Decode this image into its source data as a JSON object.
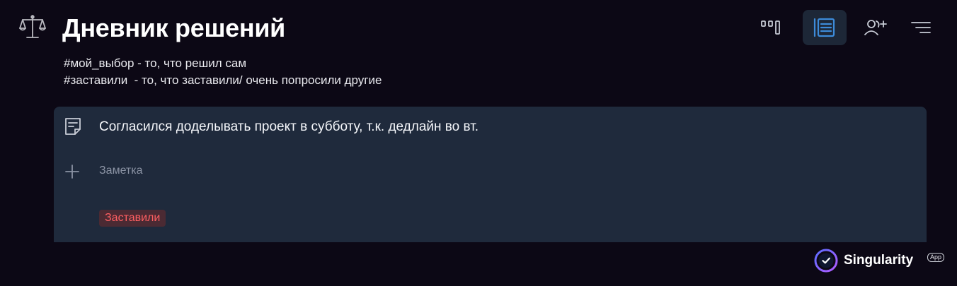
{
  "header": {
    "title": "Дневник решений",
    "description": [
      "#мой_выбор - то, что решил сам",
      "#заставили  - то, что заставили/ очень попросили другие"
    ]
  },
  "toolbar": {
    "buttons": [
      {
        "icon": "board-view-icon",
        "active": false
      },
      {
        "icon": "list-view-icon",
        "active": true
      },
      {
        "icon": "add-user-icon",
        "active": false
      },
      {
        "icon": "filter-icon",
        "active": false
      }
    ]
  },
  "task": {
    "text": "Согласился доделывать проект в субботу, т.к. дедлайн во вт.",
    "note_placeholder": "Заметка",
    "tag": "Заставили"
  },
  "brand": {
    "name": "Singularity",
    "badge": "App"
  },
  "colors": {
    "background": "#0c0815",
    "card": "#1f2a3c",
    "active_button": "#1d2737",
    "accent": "#3d8bd9",
    "tag_text": "#ff5f62",
    "tag_bg": "#4b2a33"
  }
}
